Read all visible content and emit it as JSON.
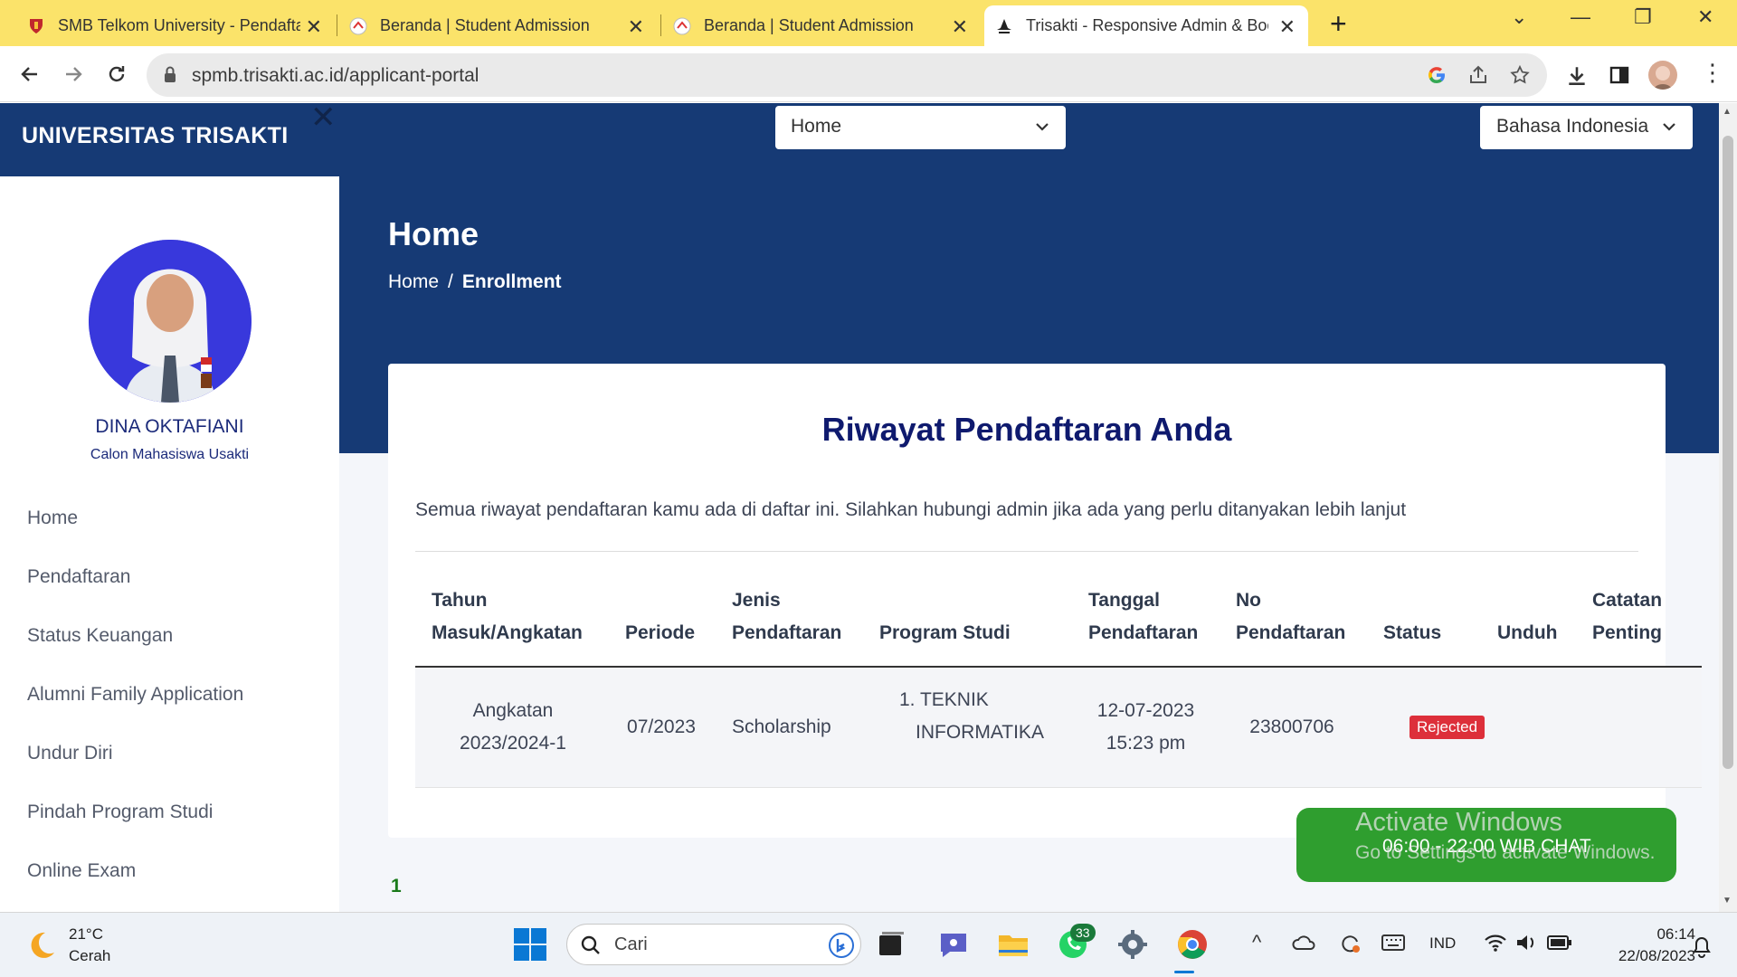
{
  "browser": {
    "tabs": [
      {
        "title": "SMB Telkom University - Pendaftaran"
      },
      {
        "title": "Beranda | Student Admission"
      },
      {
        "title": "Beranda | Student Admission"
      },
      {
        "title": "Trisakti - Responsive Admin & Bootstrap"
      }
    ],
    "active_tab": 3,
    "url": "spmb.trisakti.ac.id/applicant-portal"
  },
  "sidebar": {
    "brand": "UNIVERSITAS TRISAKTI",
    "user_name": "DINA OKTAFIANI",
    "user_role": "Calon Mahasiswa Usakti",
    "menu": [
      {
        "label": "Home"
      },
      {
        "label": "Pendaftaran"
      },
      {
        "label": "Status Keuangan"
      },
      {
        "label": "Alumni Family Application"
      },
      {
        "label": "Undur Diri"
      },
      {
        "label": "Pindah Program Studi"
      },
      {
        "label": "Online Exam"
      }
    ]
  },
  "header": {
    "nav_select": "Home",
    "language_select": "Bahasa Indonesia",
    "title": "Home",
    "breadcrumb": [
      "Home",
      "Enrollment"
    ]
  },
  "card": {
    "title": "Riwayat Pendaftaran Anda",
    "description": "Semua riwayat pendaftaran kamu ada di daftar ini. Silahkan hubungi admin jika ada yang perlu ditanyakan lebih lanjut",
    "columns": [
      {
        "line1": "Tahun",
        "line2": "Masuk/Angkatan"
      },
      {
        "line1": "",
        "line2": "Periode"
      },
      {
        "line1": "Jenis",
        "line2": "Pendaftaran"
      },
      {
        "line1": "",
        "line2": "Program Studi"
      },
      {
        "line1": "Tanggal",
        "line2": "Pendaftaran"
      },
      {
        "line1": "No",
        "line2": "Pendaftaran"
      },
      {
        "line1": "",
        "line2": "Status"
      },
      {
        "line1": "",
        "line2": "Unduh"
      },
      {
        "line1": "Catatan",
        "line2": "Penting"
      }
    ],
    "rows": [
      {
        "tahun_line1": "Angkatan",
        "tahun_line2": "2023/2024-1",
        "periode": "07/2023",
        "jenis": "Scholarship",
        "prodi_line1": "1. TEKNIK",
        "prodi_line2": "INFORMATIKA",
        "tanggal_line1": "12-07-2023",
        "tanggal_line2": "15:23 pm",
        "no": "23800706",
        "status": "Rejected",
        "unduh": "",
        "catatan": ""
      }
    ],
    "pagination": "1"
  },
  "chat_widget": {
    "label": "06:00 - 22:00 WIB CHAT"
  },
  "watermark": {
    "line1": "Activate Windows",
    "line2": "Go to Settings to activate Windows."
  },
  "taskbar": {
    "weather_temp": "21°C",
    "weather_desc": "Cerah",
    "search_placeholder": "Cari",
    "whatsapp_badge": "33",
    "language": "IND",
    "time": "06:14",
    "date": "22/08/2023"
  },
  "colors": {
    "brand_navy": "#163a75",
    "title_navy": "#0f1a6e",
    "status_rejected": "#dd2f3a",
    "chat_green": "#2f9e2f",
    "tabbar_yellow": "#fbe36a"
  }
}
